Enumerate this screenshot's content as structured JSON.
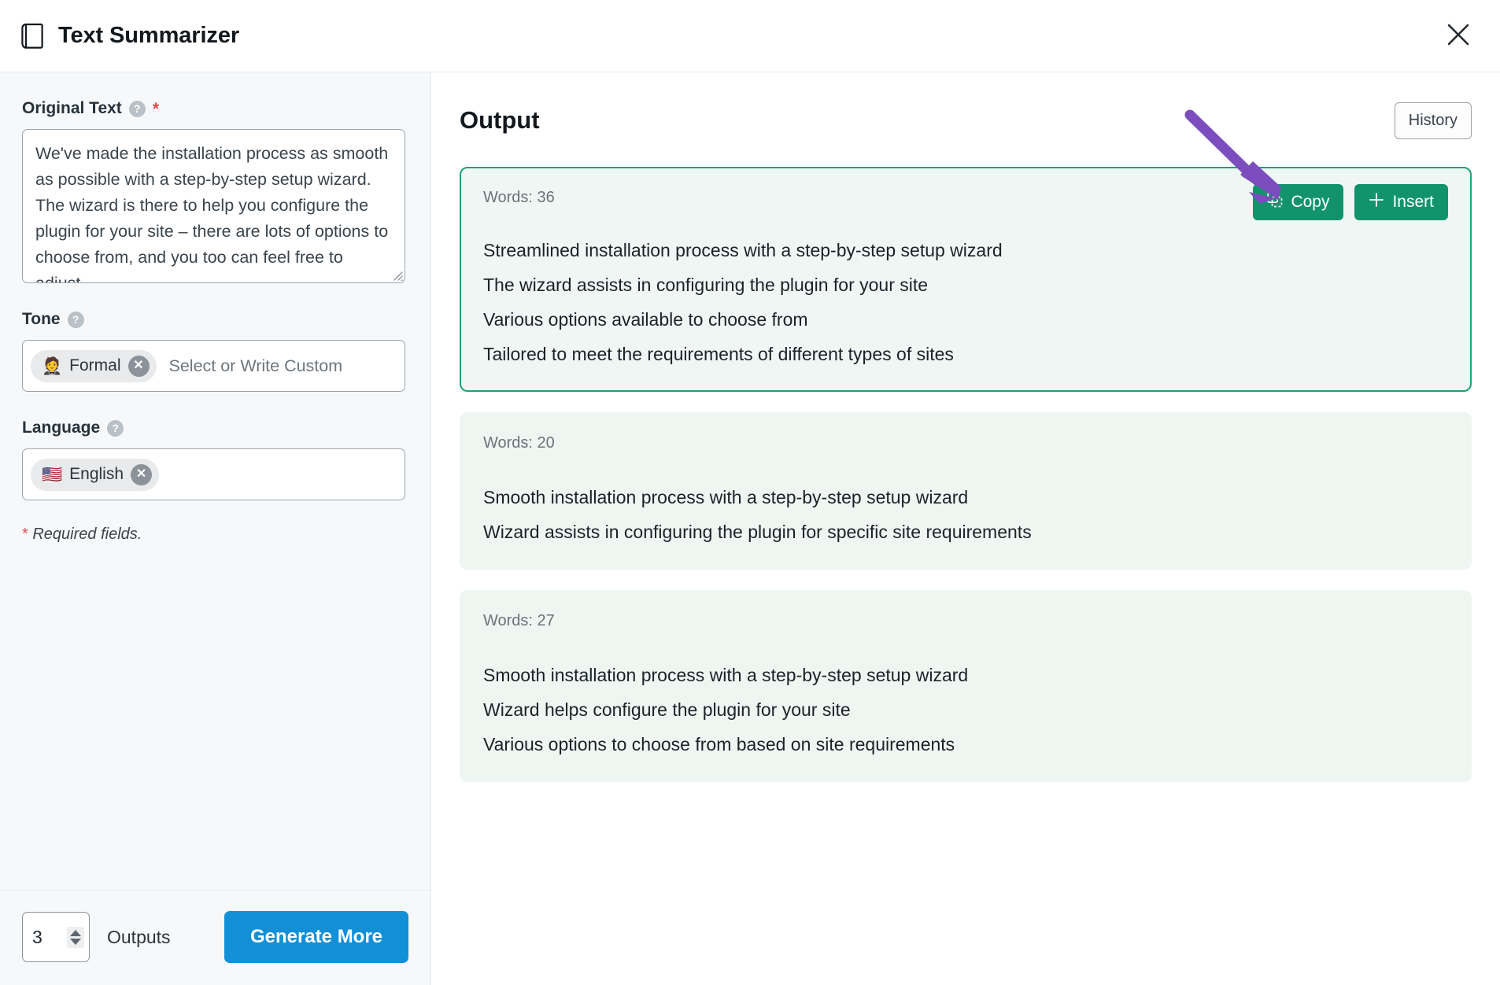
{
  "header": {
    "icon": "document-icon",
    "title": "Text Summarizer",
    "close_icon": "close-icon"
  },
  "colors": {
    "accent_blue": "#1190d8",
    "accent_green": "#12936c",
    "card_border_green": "#1ea179",
    "card_bg_mint": "#eef6f2",
    "annotation_purple": "#7c4dbe",
    "required_red": "#e0434b",
    "panel_bg": "#f7f8f9"
  },
  "form": {
    "original_text": {
      "label": "Original Text",
      "help_icon": "help-circle-icon",
      "required_marker": "*",
      "value": "We've made the installation process as smooth as possible with a step-by-step setup wizard. The wizard is there to help you configure the plugin for your site – there are lots of options to choose from, and you too can feel free to adjust",
      "resize_handle": "resize-grip-icon"
    },
    "tone": {
      "label": "Tone",
      "help_icon": "help-circle-icon",
      "chip_emoji": "🤵",
      "chip_label": "Formal",
      "chip_remove_icon": "remove-chip-icon",
      "placeholder": "Select or Write Custom"
    },
    "language": {
      "label": "Language",
      "help_icon": "help-circle-icon",
      "chip_emoji": "🇺🇸",
      "chip_label": "English",
      "chip_remove_icon": "remove-chip-icon"
    },
    "required_note_star": "*",
    "required_note": "Required fields."
  },
  "footer": {
    "outputs_value": "3",
    "outputs_label": "Outputs",
    "stepper_up_icon": "spinner-up-icon",
    "stepper_down_icon": "spinner-down-icon",
    "generate_label": "Generate More"
  },
  "output": {
    "title": "Output",
    "history_label": "History",
    "copy_label": "Copy",
    "copy_icon": "copy-icon",
    "insert_label": "Insert",
    "insert_icon": "plus-icon",
    "cards": [
      {
        "words_label": "Words: 36",
        "highlighted": true,
        "lines": [
          "Streamlined installation process with a step-by-step setup wizard",
          "The wizard assists in configuring the plugin for your site",
          "Various options available to choose from",
          "Tailored to meet the requirements of different types of sites"
        ]
      },
      {
        "words_label": "Words: 20",
        "highlighted": false,
        "lines": [
          "Smooth installation process with a step-by-step setup wizard",
          "Wizard assists in configuring the plugin for specific site requirements"
        ]
      },
      {
        "words_label": "Words: 27",
        "highlighted": false,
        "lines": [
          "Smooth installation process with a step-by-step setup wizard",
          "Wizard helps configure the plugin for your site",
          "Various options to choose from based on site requirements"
        ]
      }
    ]
  },
  "annotation": {
    "type": "arrow",
    "points_to": "copy-button"
  }
}
